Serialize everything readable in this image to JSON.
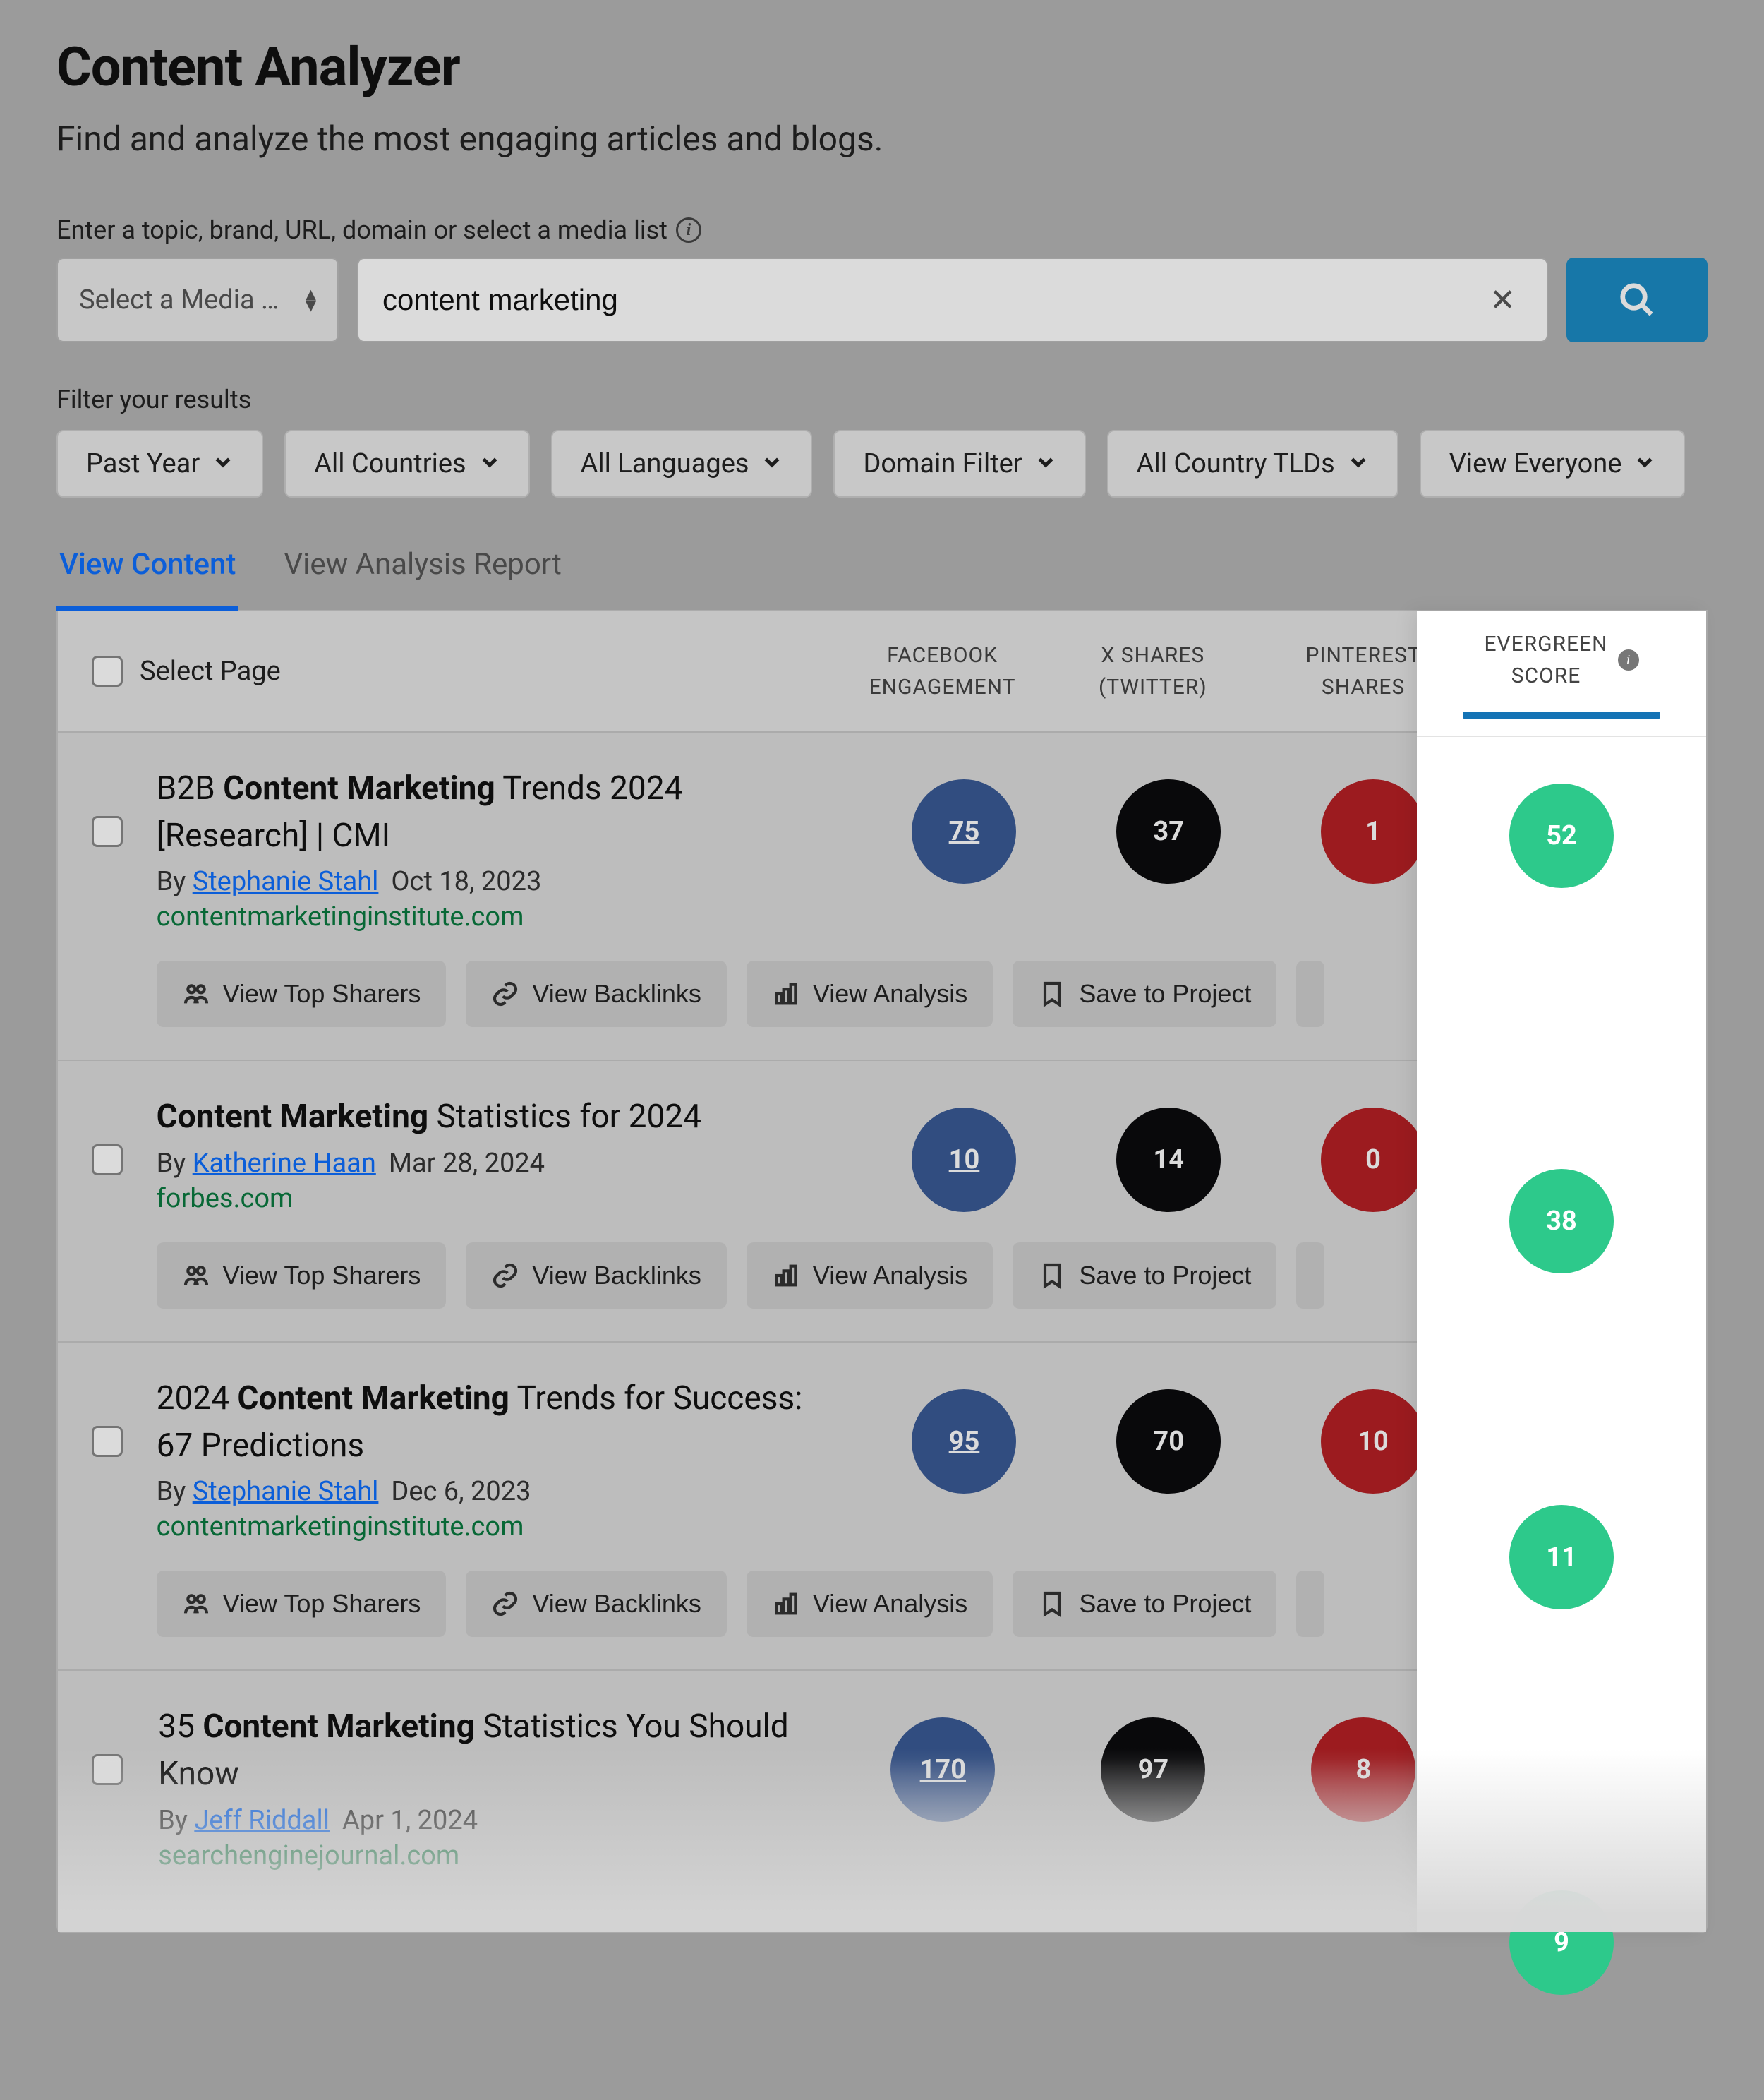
{
  "page": {
    "title": "Content Analyzer",
    "subtitle": "Find and analyze the most engaging articles and blogs."
  },
  "search": {
    "label": "Enter a topic, brand, URL, domain or select a media list",
    "media_select_placeholder": "Select a Media …",
    "input_value": "content marketing"
  },
  "filters": {
    "label": "Filter your results",
    "items": [
      "Past Year",
      "All Countries",
      "All Languages",
      "Domain Filter",
      "All Country TLDs",
      "View Everyone"
    ]
  },
  "tabs": {
    "content": "View Content",
    "analysis": "View Analysis Report"
  },
  "table": {
    "select_page": "Select Page",
    "columns": {
      "facebook": "FACEBOOK ENGAGEMENT",
      "x": "X SHARES (TWITTER)",
      "pinterest": "PINTEREST SHARES",
      "evergreen": "EVERGREEN SCORE"
    }
  },
  "actions": {
    "top_sharers": "View Top Sharers",
    "backlinks": "View Backlinks",
    "analysis": "View Analysis",
    "save": "Save to Project"
  },
  "results": [
    {
      "title_pre": "B2B ",
      "title_bold": "Content Marketing",
      "title_post": " Trends 2024 [Research] | CMI",
      "by": "By ",
      "author": "Stephanie Stahl",
      "date": "Oct 18, 2023",
      "domain": "contentmarketinginstitute.com",
      "fb": "75",
      "tw": "37",
      "pin": "1",
      "eg": "52"
    },
    {
      "title_pre": "",
      "title_bold": "Content Marketing",
      "title_post": " Statistics for 2024",
      "by": "By ",
      "author": "Katherine Haan",
      "date": "Mar 28, 2024",
      "domain": "forbes.com",
      "fb": "10",
      "tw": "14",
      "pin": "0",
      "eg": "38"
    },
    {
      "title_pre": "2024 ",
      "title_bold": "Content Marketing",
      "title_post": " Trends for Success: 67 Predictions",
      "by": "By ",
      "author": "Stephanie Stahl",
      "date": "Dec 6, 2023",
      "domain": "contentmarketinginstitute.com",
      "fb": "95",
      "tw": "70",
      "pin": "10",
      "eg": "11"
    },
    {
      "title_pre": "35 ",
      "title_bold": "Content Marketing",
      "title_post": " Statistics You Should Know",
      "by": "By ",
      "author": "Jeff Riddall",
      "date": "Apr 1, 2024",
      "domain": "searchenginejournal.com",
      "fb": "170",
      "tw": "97",
      "pin": "8",
      "eg": "9"
    }
  ]
}
